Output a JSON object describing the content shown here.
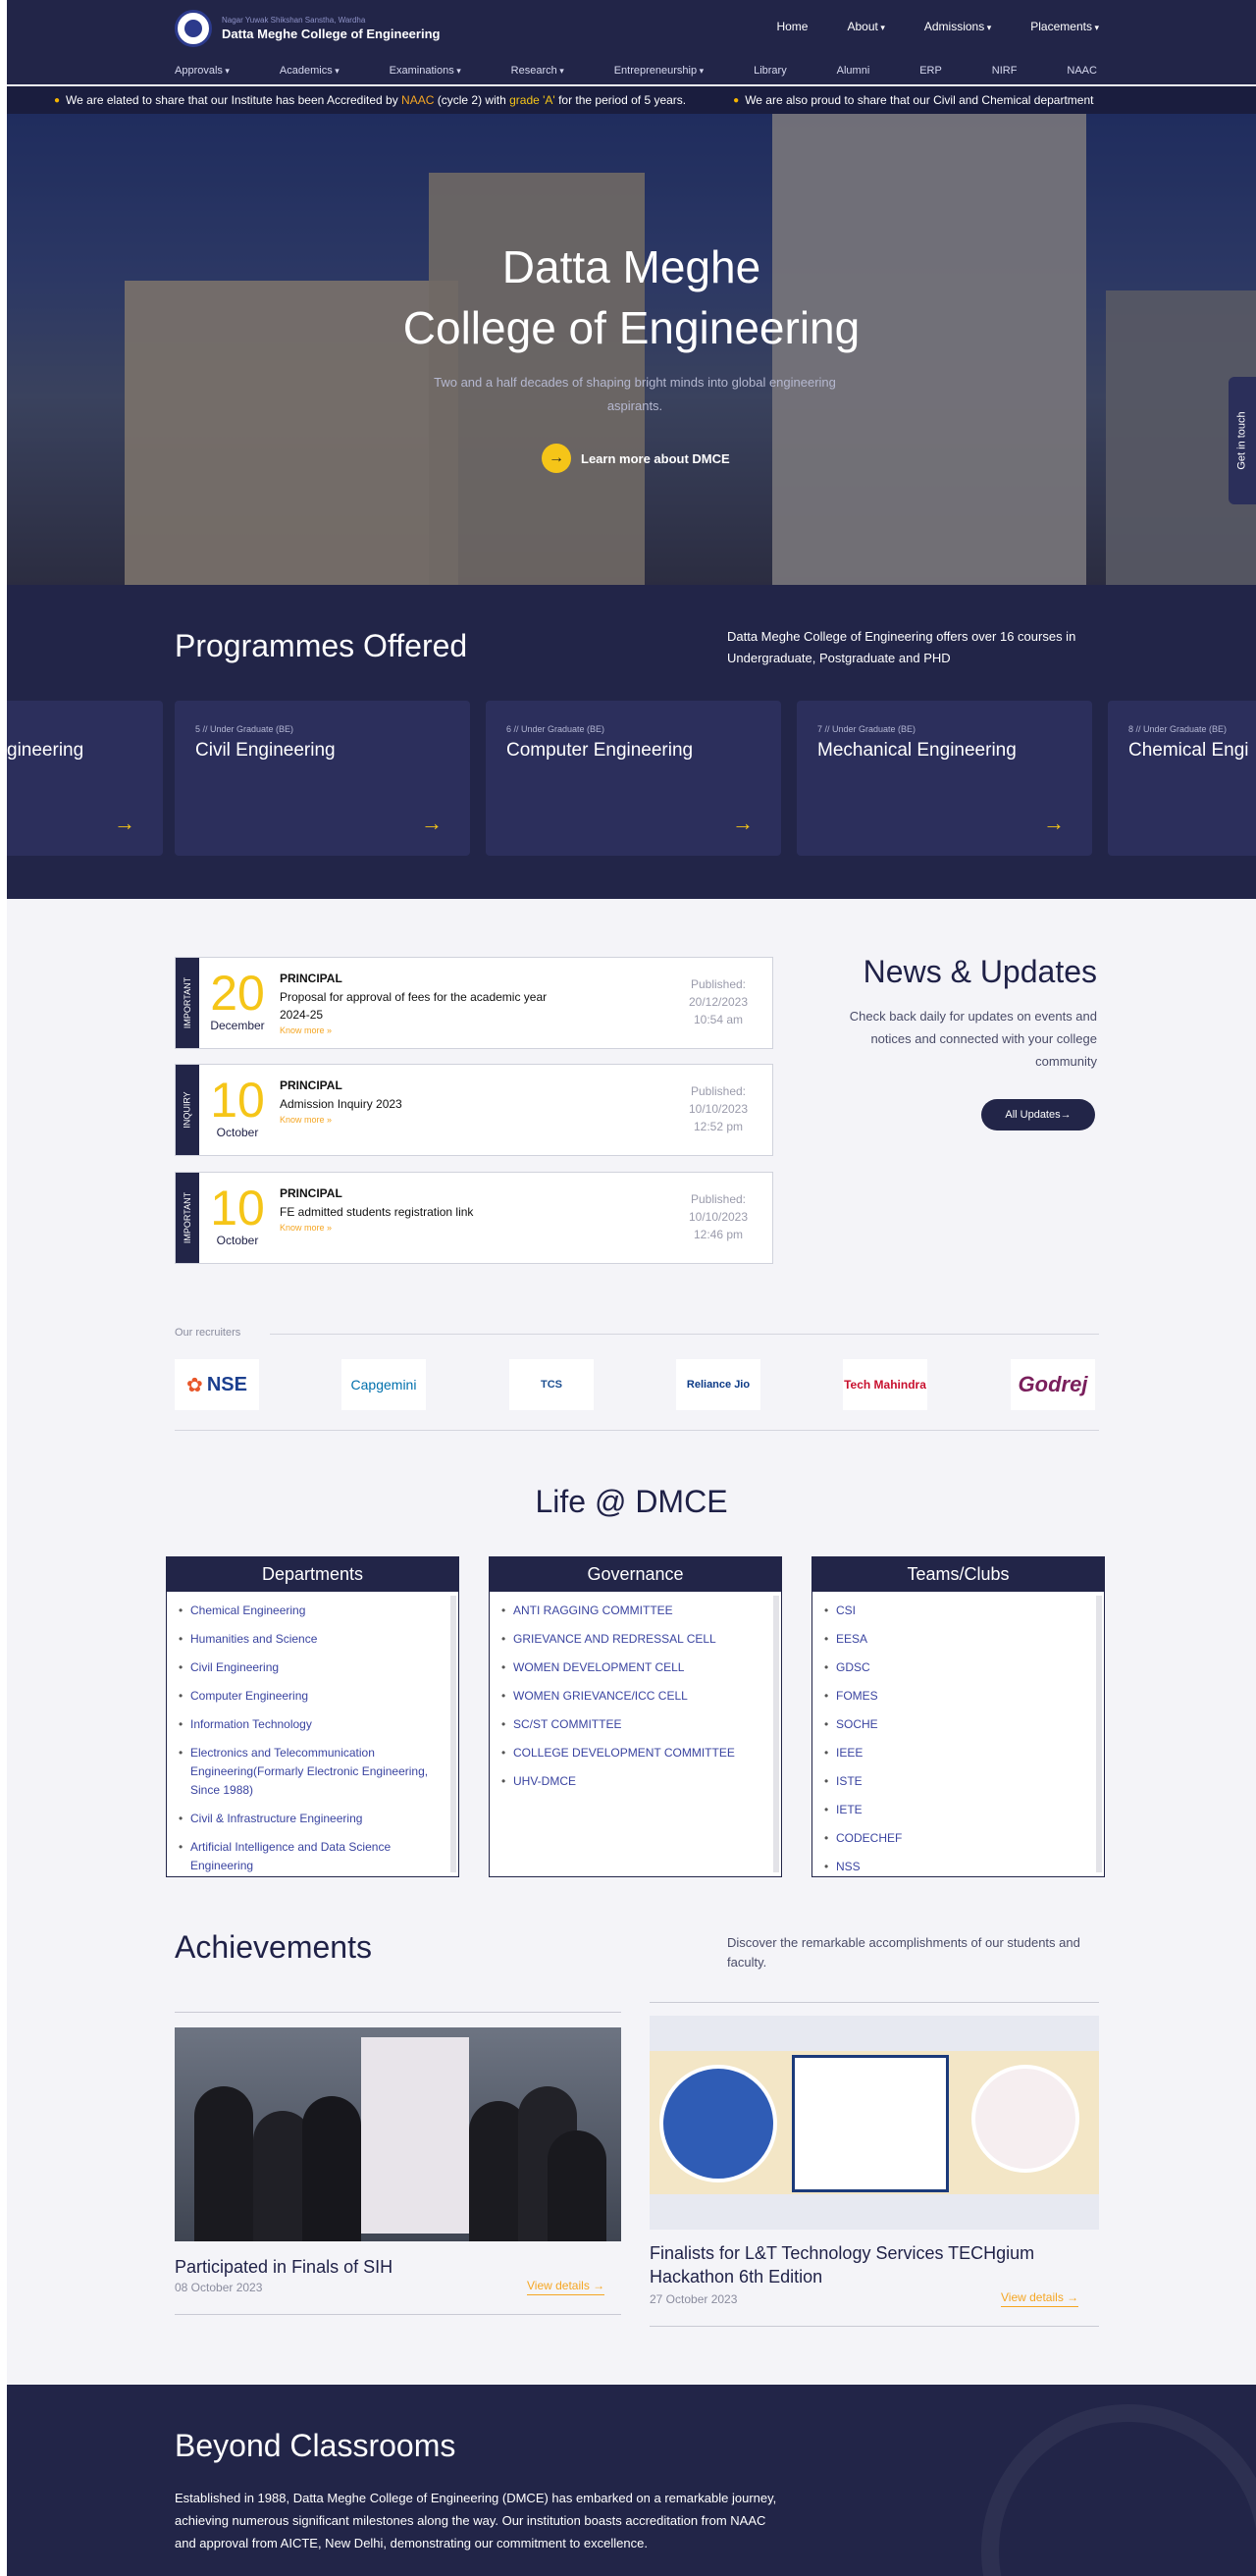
{
  "header": {
    "org": "Nagar Yuwak Shikshan Sanstha, Wardha",
    "college": "Datta Meghe College of Engineering",
    "top_nav": [
      "Home",
      "About",
      "Admissions",
      "Placements"
    ],
    "sub_nav": [
      "Approvals",
      "Academics",
      "Examinations",
      "Research",
      "Entrepreneurship",
      "Library",
      "Alumni",
      "ERP",
      "NIRF",
      "NAAC"
    ]
  },
  "ticker": {
    "t1_pre": "We are elated to share that our Institute has been Accredited by ",
    "t1_naac": "NAAC",
    "t1_mid": " (cycle 2) with ",
    "t1_grade": "grade 'A'",
    "t1_post": " for the period of 5 years.",
    "t2": "We are also proud to share that our Civil and Chemical department"
  },
  "hero": {
    "line1": "Datta Meghe",
    "line2": "College of Engineering",
    "subtitle": "Two and a half decades of shaping bright minds into global engineering aspirants.",
    "cta": "Learn more about DMCE",
    "get_in_touch": "Get in touch"
  },
  "programmes": {
    "title": "Programmes Offered",
    "description": "Datta Meghe College of Engineering offers over 16 courses in Undergraduate, Postgraduate and PHD",
    "cards": [
      {
        "meta": "",
        "name": "gineering"
      },
      {
        "meta": "5 // Under Graduate (BE)",
        "name": "Civil Engineering"
      },
      {
        "meta": "6 // Under Graduate (BE)",
        "name": "Computer Engineering"
      },
      {
        "meta": "7 // Under Graduate (BE)",
        "name": "Mechanical Engineering"
      },
      {
        "meta": "8 // Under Graduate (BE)",
        "name": "Chemical Engi"
      }
    ]
  },
  "news": {
    "title": "News & Updates",
    "description": "Check back daily for updates on events and notices and connected with your college community",
    "button": "All Updates",
    "items": [
      {
        "tag": "IMPORTANT",
        "day": "20",
        "month": "December",
        "who": "PRINCIPAL",
        "subject": "Proposal for approval of fees for the academic year 2024-25",
        "more": "Know more »",
        "pub_label": "Published:",
        "pub_date": "20/12/2023",
        "pub_time": "10:54 am"
      },
      {
        "tag": "INQUIRY",
        "day": "10",
        "month": "October",
        "who": "PRINCIPAL",
        "subject": "Admission Inquiry 2023",
        "more": "Know more »",
        "pub_label": "Published:",
        "pub_date": "10/10/2023",
        "pub_time": "12:52 pm"
      },
      {
        "tag": "IMPORTANT",
        "day": "10",
        "month": "October",
        "who": "PRINCIPAL",
        "subject": "FE admitted students registration link",
        "more": "Know more »",
        "pub_label": "Published:",
        "pub_date": "10/10/2023",
        "pub_time": "12:46 pm"
      }
    ]
  },
  "recruiters": {
    "label": "Our recruiters",
    "logos": [
      "NSE",
      "Capgemini",
      "TCS",
      "Reliance Jio",
      "Tech Mahindra",
      "Godrej"
    ]
  },
  "life": {
    "title": "Life @ DMCE",
    "departments": {
      "title": "Departments",
      "items": [
        "Chemical Engineering",
        "Humanities and Science",
        "Civil Engineering",
        "Computer Engineering",
        "Information Technology",
        "Electronics and Telecommunication Engineering(Formarly Electronic Engineering, Since 1988)",
        "Civil & Infrastructure Engineering",
        "Artificial Intelligence and Data Science Engineering"
      ]
    },
    "governance": {
      "title": "Governance",
      "items": [
        "ANTI RAGGING COMMITTEE",
        "GRIEVANCE AND REDRESSAL CELL",
        "WOMEN DEVELOPMENT CELL",
        "WOMEN GRIEVANCE/ICC CELL",
        "SC/ST COMMITTEE",
        "COLLEGE DEVELOPMENT COMMITTEE",
        "UHV-DMCE"
      ]
    },
    "teams": {
      "title": "Teams/Clubs",
      "items": [
        "CSI",
        "EESA",
        "GDSC",
        "FOMES",
        "SOCHE",
        "IEEE",
        "ISTE",
        "IETE",
        "CODECHEF",
        "NSS"
      ]
    }
  },
  "achievements": {
    "title": "Achievements",
    "description": "Discover the remarkable accomplishments of our students and faculty.",
    "items": [
      {
        "name": "Participated in Finals of SIH",
        "date": "08 October 2023",
        "link": "View details"
      },
      {
        "name": "Finalists for L&T Technology Services TECHgium Hackathon 6th Edition",
        "date": "27 October 2023",
        "link": "View details"
      }
    ]
  },
  "beyond": {
    "title": "Beyond Classrooms",
    "text": "Established in 1988, Datta Meghe College of Engineering (DMCE) has embarked on a remarkable journey, achieving numerous significant milestones along the way. Our institution boasts accreditation from NAAC and approval from AICTE, New Delhi, demonstrating our commitment to excellence."
  },
  "colors": {
    "navy": "#222548",
    "accent_yellow": "#f5c518",
    "accent_orange": "#f5a623"
  }
}
